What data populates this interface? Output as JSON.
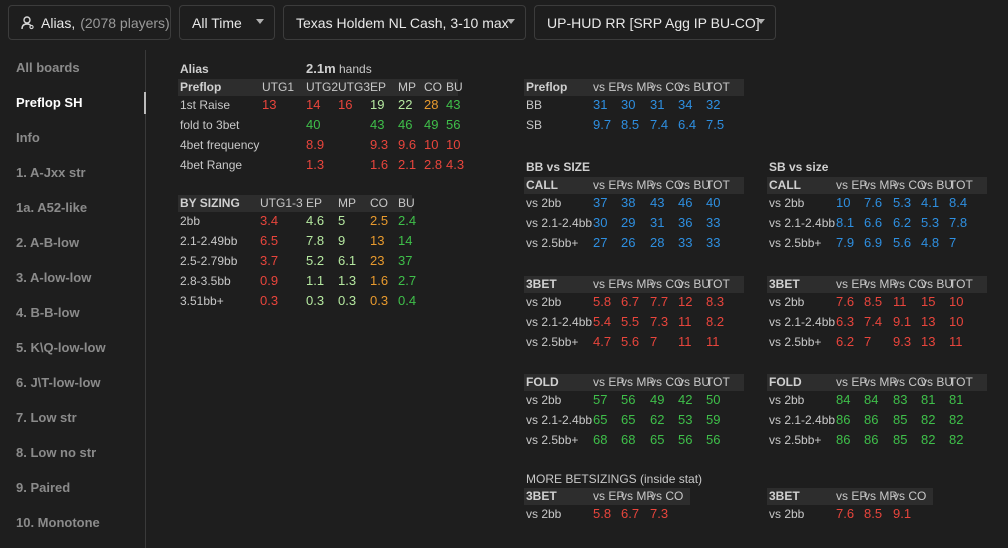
{
  "topbar": {
    "alias_label": "Alias,",
    "alias_players": "(2078 players)",
    "time_filter": "All Time",
    "game_filter": "Texas Holdem NL Cash, 3-10 max",
    "hud_filter": "UP-HUD RR [SRP Agg IP BU-CO]"
  },
  "sidebar": {
    "items": [
      {
        "label": "All boards"
      },
      {
        "label": "Preflop SH"
      },
      {
        "label": "Info"
      },
      {
        "label": "1. A-Jxx str"
      },
      {
        "label": "1a. A52-like"
      },
      {
        "label": "2. A-B-low"
      },
      {
        "label": "3. A-low-low"
      },
      {
        "label": "4. B-B-low"
      },
      {
        "label": "5. K\\Q-low-low"
      },
      {
        "label": "6. J\\T-low-low"
      },
      {
        "label": "7. Low str"
      },
      {
        "label": "8. Low no str"
      },
      {
        "label": "9. Paired"
      },
      {
        "label": "10. Monotone"
      }
    ],
    "active_index": 1
  },
  "preflop": {
    "alias": "Alias",
    "hands_count": "2.1m",
    "hands_label": "hands",
    "title": "Preflop",
    "cols": [
      "UTG1",
      "UTG2",
      "UTG3",
      "EP",
      "MP",
      "CO",
      "BU"
    ],
    "rows": [
      {
        "label": "1st Raise",
        "cells": [
          [
            "13",
            "red"
          ],
          [
            "14",
            "red"
          ],
          [
            "16",
            "red"
          ],
          [
            "19",
            "lgrn"
          ],
          [
            "22",
            "lgrn"
          ],
          [
            "28",
            "orange"
          ],
          [
            "43",
            "grn"
          ]
        ]
      },
      {
        "label": "fold to 3bet",
        "cells": [
          [
            "",
            ""
          ],
          [
            "40",
            "grn"
          ],
          [
            "",
            ""
          ],
          [
            "43",
            "grn"
          ],
          [
            "46",
            "grn"
          ],
          [
            "49",
            "grn"
          ],
          [
            "56",
            "grn"
          ]
        ]
      },
      {
        "label": "4bet frequency",
        "cells": [
          [
            "",
            ""
          ],
          [
            "8.9",
            "red"
          ],
          [
            "",
            ""
          ],
          [
            "9.3",
            "red"
          ],
          [
            "9.6",
            "red"
          ],
          [
            "10",
            "red"
          ],
          [
            "10",
            "red"
          ]
        ]
      },
      {
        "label": "4bet Range",
        "cells": [
          [
            "",
            ""
          ],
          [
            "1.3",
            "red"
          ],
          [
            "",
            ""
          ],
          [
            "1.6",
            "red"
          ],
          [
            "2.1",
            "red"
          ],
          [
            "2.8",
            "red"
          ],
          [
            "4.3",
            "red"
          ]
        ]
      }
    ]
  },
  "bysizing": {
    "title": "BY SIZING",
    "cols": [
      "UTG1-3",
      "EP",
      "MP",
      "CO",
      "BU"
    ],
    "rows": [
      {
        "label": "2bb",
        "cells": [
          [
            "3.4",
            "red"
          ],
          [
            "4.6",
            "lgrn"
          ],
          [
            "5",
            "lgrn"
          ],
          [
            "2.5",
            "orange"
          ],
          [
            "2.4",
            "grn"
          ]
        ]
      },
      {
        "label": "2.1-2.49bb",
        "cells": [
          [
            "6.5",
            "red"
          ],
          [
            "7.8",
            "lgrn"
          ],
          [
            "9",
            "lgrn"
          ],
          [
            "13",
            "orange"
          ],
          [
            "14",
            "grn"
          ]
        ]
      },
      {
        "label": "2.5-2.79bb",
        "cells": [
          [
            "3.7",
            "red"
          ],
          [
            "5.2",
            "lgrn"
          ],
          [
            "6.1",
            "lgrn"
          ],
          [
            "23",
            "orange"
          ],
          [
            "37",
            "grn"
          ]
        ]
      },
      {
        "label": "2.8-3.5bb",
        "cells": [
          [
            "0.9",
            "red"
          ],
          [
            "1.1",
            "lgrn"
          ],
          [
            "1.3",
            "lgrn"
          ],
          [
            "1.6",
            "orange"
          ],
          [
            "2.7",
            "grn"
          ]
        ]
      },
      {
        "label": "3.51bb+",
        "cells": [
          [
            "0.3",
            "red"
          ],
          [
            "0.3",
            "lgrn"
          ],
          [
            "0.3",
            "lgrn"
          ],
          [
            "0.3",
            "orange"
          ],
          [
            "0.4",
            "grn"
          ]
        ]
      }
    ]
  },
  "bbsb_preflop": {
    "title": "Preflop",
    "cols": [
      "vs EP",
      "vs MP",
      "vs CO",
      "vs BU",
      "TOT"
    ],
    "rows": [
      {
        "label": "BB",
        "cells": [
          [
            "31",
            "blue"
          ],
          [
            "30",
            "blue"
          ],
          [
            "31",
            "blue"
          ],
          [
            "34",
            "blue"
          ],
          [
            "32",
            "blue"
          ]
        ]
      },
      {
        "label": "SB",
        "cells": [
          [
            "9.7",
            "blue"
          ],
          [
            "8.5",
            "blue"
          ],
          [
            "7.4",
            "blue"
          ],
          [
            "6.4",
            "blue"
          ],
          [
            "7.5",
            "blue"
          ]
        ]
      }
    ]
  },
  "bb_vs_size_title": "BB vs SIZE",
  "sb_vs_size_title": "SB vs size",
  "more_betsizings_title": "MORE BETSIZINGS (inside stat)",
  "bb_call": {
    "title": "CALL",
    "cols": [
      "vs EP",
      "vs MP",
      "vs CO",
      "vs BU",
      "TOT"
    ],
    "rows": [
      {
        "label": "vs 2bb",
        "cells": [
          [
            "37",
            "blue"
          ],
          [
            "38",
            "blue"
          ],
          [
            "43",
            "blue"
          ],
          [
            "46",
            "blue"
          ],
          [
            "40",
            "blue"
          ]
        ]
      },
      {
        "label": "vs 2.1-2.4bb",
        "cells": [
          [
            "30",
            "blue"
          ],
          [
            "29",
            "blue"
          ],
          [
            "31",
            "blue"
          ],
          [
            "36",
            "blue"
          ],
          [
            "33",
            "blue"
          ]
        ]
      },
      {
        "label": "vs 2.5bb+",
        "cells": [
          [
            "27",
            "blue"
          ],
          [
            "26",
            "blue"
          ],
          [
            "28",
            "blue"
          ],
          [
            "33",
            "blue"
          ],
          [
            "33",
            "blue"
          ]
        ]
      }
    ]
  },
  "sb_call": {
    "title": "CALL",
    "cols": [
      "vs EP",
      "vs MP",
      "vs CO",
      "vs BU",
      "TOT"
    ],
    "rows": [
      {
        "label": "vs 2bb",
        "cells": [
          [
            "10",
            "blue"
          ],
          [
            "7.6",
            "blue"
          ],
          [
            "5.3",
            "blue"
          ],
          [
            "4.1",
            "blue"
          ],
          [
            "8.4",
            "blue"
          ]
        ]
      },
      {
        "label": "vs 2.1-2.4bb",
        "cells": [
          [
            "8.1",
            "blue"
          ],
          [
            "6.6",
            "blue"
          ],
          [
            "6.2",
            "blue"
          ],
          [
            "5.3",
            "blue"
          ],
          [
            "7.8",
            "blue"
          ]
        ]
      },
      {
        "label": "vs 2.5bb+",
        "cells": [
          [
            "7.9",
            "blue"
          ],
          [
            "6.9",
            "blue"
          ],
          [
            "5.6",
            "blue"
          ],
          [
            "4.8",
            "blue"
          ],
          [
            "7",
            "blue"
          ]
        ]
      }
    ]
  },
  "bb_3bet": {
    "title": "3BET",
    "cols": [
      "vs EP",
      "vs MP",
      "vs CO",
      "vs BU",
      "TOT"
    ],
    "rows": [
      {
        "label": "vs 2bb",
        "cells": [
          [
            "5.8",
            "red"
          ],
          [
            "6.7",
            "red"
          ],
          [
            "7.7",
            "red"
          ],
          [
            "12",
            "red"
          ],
          [
            "8.3",
            "red"
          ]
        ]
      },
      {
        "label": "vs 2.1-2.4bb",
        "cells": [
          [
            "5.4",
            "red"
          ],
          [
            "5.5",
            "red"
          ],
          [
            "7.3",
            "red"
          ],
          [
            "11",
            "red"
          ],
          [
            "8.2",
            "red"
          ]
        ]
      },
      {
        "label": "vs 2.5bb+",
        "cells": [
          [
            "4.7",
            "red"
          ],
          [
            "5.6",
            "red"
          ],
          [
            "7",
            "red"
          ],
          [
            "11",
            "red"
          ],
          [
            "11",
            "red"
          ]
        ]
      }
    ]
  },
  "sb_3bet": {
    "title": "3BET",
    "cols": [
      "vs EP",
      "vs MP",
      "vs CO",
      "vs BU",
      "TOT"
    ],
    "rows": [
      {
        "label": "vs 2bb",
        "cells": [
          [
            "7.6",
            "red"
          ],
          [
            "8.5",
            "red"
          ],
          [
            "11",
            "red"
          ],
          [
            "15",
            "red"
          ],
          [
            "10",
            "red"
          ]
        ]
      },
      {
        "label": "vs 2.1-2.4bb",
        "cells": [
          [
            "6.3",
            "red"
          ],
          [
            "7.4",
            "red"
          ],
          [
            "9.1",
            "red"
          ],
          [
            "13",
            "red"
          ],
          [
            "10",
            "red"
          ]
        ]
      },
      {
        "label": "vs 2.5bb+",
        "cells": [
          [
            "6.2",
            "red"
          ],
          [
            "7",
            "red"
          ],
          [
            "9.3",
            "red"
          ],
          [
            "13",
            "red"
          ],
          [
            "11",
            "red"
          ]
        ]
      }
    ]
  },
  "bb_fold": {
    "title": "FOLD",
    "cols": [
      "vs EP",
      "vs MP",
      "vs CO",
      "vs BU",
      "TOT"
    ],
    "rows": [
      {
        "label": "vs 2bb",
        "cells": [
          [
            "57",
            "grn"
          ],
          [
            "56",
            "grn"
          ],
          [
            "49",
            "grn"
          ],
          [
            "42",
            "grn"
          ],
          [
            "50",
            "grn"
          ]
        ]
      },
      {
        "label": "vs 2.1-2.4bb",
        "cells": [
          [
            "65",
            "grn"
          ],
          [
            "65",
            "grn"
          ],
          [
            "62",
            "grn"
          ],
          [
            "53",
            "grn"
          ],
          [
            "59",
            "grn"
          ]
        ]
      },
      {
        "label": "vs 2.5bb+",
        "cells": [
          [
            "68",
            "grn"
          ],
          [
            "68",
            "grn"
          ],
          [
            "65",
            "grn"
          ],
          [
            "56",
            "grn"
          ],
          [
            "56",
            "grn"
          ]
        ]
      }
    ]
  },
  "sb_fold": {
    "title": "FOLD",
    "cols": [
      "vs EP",
      "vs MP",
      "vs CO",
      "vs BU",
      "TOT"
    ],
    "rows": [
      {
        "label": "vs 2bb",
        "cells": [
          [
            "84",
            "grn"
          ],
          [
            "84",
            "grn"
          ],
          [
            "83",
            "grn"
          ],
          [
            "81",
            "grn"
          ],
          [
            "81",
            "grn"
          ]
        ]
      },
      {
        "label": "vs 2.1-2.4bb",
        "cells": [
          [
            "86",
            "grn"
          ],
          [
            "86",
            "grn"
          ],
          [
            "85",
            "grn"
          ],
          [
            "82",
            "grn"
          ],
          [
            "82",
            "grn"
          ]
        ]
      },
      {
        "label": "vs 2.5bb+",
        "cells": [
          [
            "86",
            "grn"
          ],
          [
            "86",
            "grn"
          ],
          [
            "85",
            "grn"
          ],
          [
            "82",
            "grn"
          ],
          [
            "82",
            "grn"
          ]
        ]
      }
    ]
  },
  "more_bb_3bet": {
    "title": "3BET",
    "cols": [
      "vs EP",
      "vs MP",
      "vs CO"
    ],
    "rows": [
      {
        "label": "vs 2bb",
        "cells": [
          [
            "5.8",
            "red"
          ],
          [
            "6.7",
            "red"
          ],
          [
            "7.3",
            "red"
          ]
        ]
      }
    ]
  },
  "more_sb_3bet": {
    "title": "3BET",
    "cols": [
      "vs EP",
      "vs MP",
      "vs CO"
    ],
    "rows": [
      {
        "label": "vs 2bb",
        "cells": [
          [
            "7.6",
            "red"
          ],
          [
            "8.5",
            "red"
          ],
          [
            "9.1",
            "red"
          ]
        ]
      }
    ]
  }
}
